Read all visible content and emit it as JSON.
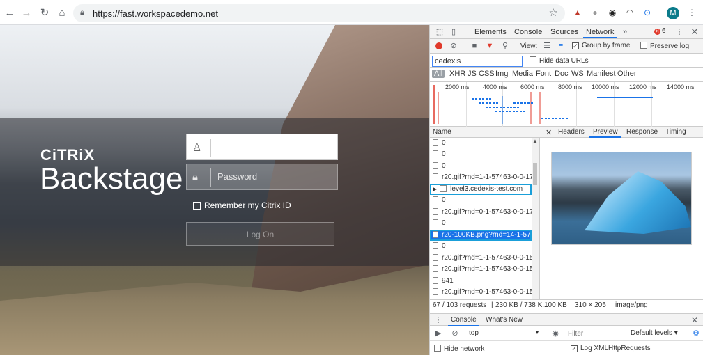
{
  "browser": {
    "url": "https://fast.workspacedemo.net",
    "avatar_letter": "M"
  },
  "page": {
    "brand_top": "CiTRiX",
    "brand_title": "Backstage",
    "username_placeholder": "",
    "password_placeholder": "Password",
    "remember_label": "Remember my Citrix ID",
    "login_label": "Log On"
  },
  "devtools": {
    "tabs": [
      "Elements",
      "Console",
      "Sources",
      "Network"
    ],
    "active_tab": "Network",
    "error_count": "6",
    "toolbar": {
      "view_label": "View:",
      "group_by_frame": "Group by frame",
      "preserve_log": "Preserve log"
    },
    "filter_value": "cedexis",
    "hide_data_urls": "Hide data URLs",
    "type_filters": [
      "All",
      "XHR",
      "JS",
      "CSS",
      "Img",
      "Media",
      "Font",
      "Doc",
      "WS",
      "Manifest",
      "Other"
    ],
    "timeline_ticks": [
      "2000 ms",
      "4000 ms",
      "6000 ms",
      "8000 ms",
      "10000 ms",
      "12000 ms",
      "14000 ms"
    ],
    "name_header": "Name",
    "preview_tabs": [
      "Headers",
      "Preview",
      "Response",
      "Timing"
    ],
    "active_preview_tab": "Preview",
    "requests": [
      "0",
      "0",
      "0",
      "r20.gif?rnd=1-1-57463-0-0-17",
      "level3.cedexis-test.com",
      "0",
      "r20.gif?rnd=0-1-57463-0-0-17",
      "0",
      "r20-100KB.png?rnd=14-1-574",
      "0",
      "r20.gif?rnd=1-1-57463-0-0-15",
      "r20.gif?rnd=1-1-57463-0-0-15",
      "941",
      "r20.gif?rnd=0-1-57463-0-0-15"
    ],
    "status_requests": "67 / 103 requests",
    "status_transfer": "230 KB / 738 K...",
    "image_size": "100 KB",
    "image_dims": "310 × 205",
    "image_type": "image/png",
    "drawer_tabs": [
      "Console",
      "What's New"
    ],
    "context": "top",
    "drawer_filter_placeholder": "Filter",
    "log_levels": "Default levels ▾",
    "hide_network": "Hide network",
    "log_xhr": "Log XMLHttpRequests"
  }
}
